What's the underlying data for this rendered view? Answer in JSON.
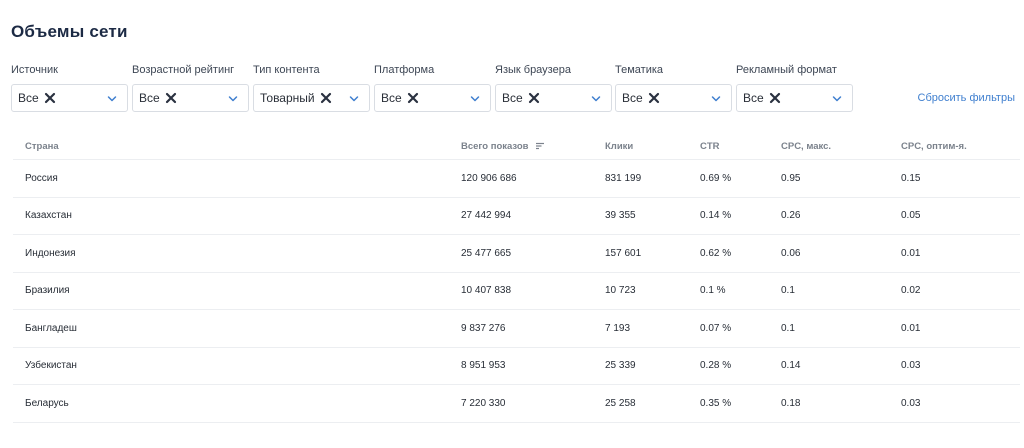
{
  "page": {
    "title": "Объемы сети"
  },
  "filters": [
    {
      "label": "Источник",
      "value": "Все"
    },
    {
      "label": "Возрастной рейтинг",
      "value": "Все"
    },
    {
      "label": "Тип контента",
      "value": "Товарный"
    },
    {
      "label": "Платформа",
      "value": "Все"
    },
    {
      "label": "Язык браузера",
      "value": "Все"
    },
    {
      "label": "Тематика",
      "value": "Все"
    },
    {
      "label": "Рекламный формат",
      "value": "Все"
    }
  ],
  "reset_label": "Сбросить фильтры",
  "table": {
    "headers": {
      "country": "Страна",
      "shows": "Всего показов",
      "clicks": "Клики",
      "ctr": "CTR",
      "cpc_max": "CPC, макс.",
      "cpc_opt": "CPC, оптим-я."
    },
    "rows": [
      {
        "country": "Россия",
        "shows": "120 906 686",
        "clicks": "831 199",
        "ctr": "0.69 %",
        "cpc_max": "0.95",
        "cpc_opt": "0.15"
      },
      {
        "country": "Казахстан",
        "shows": "27 442 994",
        "clicks": "39 355",
        "ctr": "0.14 %",
        "cpc_max": "0.26",
        "cpc_opt": "0.05"
      },
      {
        "country": "Индонезия",
        "shows": "25 477 665",
        "clicks": "157 601",
        "ctr": "0.62 %",
        "cpc_max": "0.06",
        "cpc_opt": "0.01"
      },
      {
        "country": "Бразилия",
        "shows": "10 407 838",
        "clicks": "10 723",
        "ctr": "0.1 %",
        "cpc_max": "0.1",
        "cpc_opt": "0.02"
      },
      {
        "country": "Бангладеш",
        "shows": "9 837 276",
        "clicks": "7 193",
        "ctr": "0.07 %",
        "cpc_max": "0.1",
        "cpc_opt": "0.01"
      },
      {
        "country": "Узбекистан",
        "shows": "8 951 953",
        "clicks": "25 339",
        "ctr": "0.28 %",
        "cpc_max": "0.14",
        "cpc_opt": "0.03"
      },
      {
        "country": "Беларусь",
        "shows": "7 220 330",
        "clicks": "25 258",
        "ctr": "0.35 %",
        "cpc_max": "0.18",
        "cpc_opt": "0.03"
      }
    ]
  },
  "icons": {
    "chip_remove": "close-icon",
    "dropdown": "chevron-down-icon",
    "sort": "sort-icon"
  },
  "colors": {
    "title": "#1c2a44",
    "link": "#3f7fcf",
    "chevron": "#3f7fcf",
    "border": "#d9dde3"
  }
}
